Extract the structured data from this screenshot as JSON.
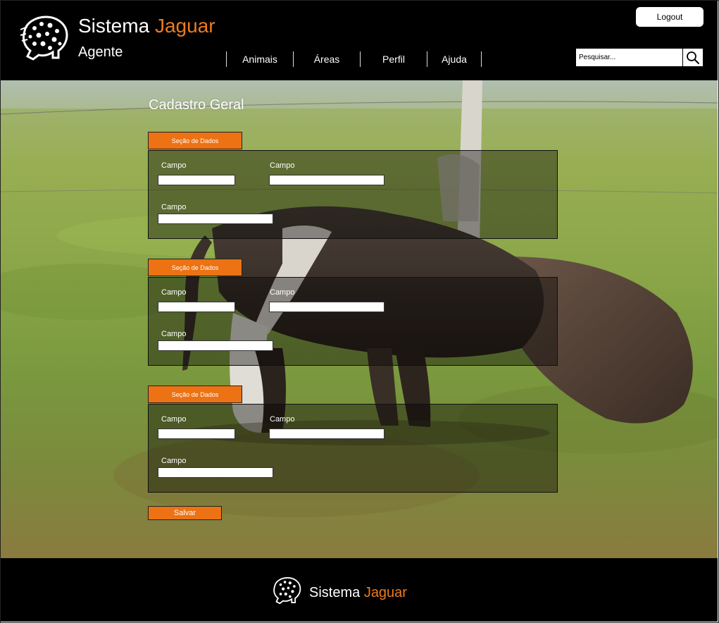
{
  "header": {
    "brand_prefix": "Sistema",
    "brand_accent": "Jaguar",
    "subtitle": "Agente",
    "logout_label": "Logout",
    "nav": [
      {
        "label": "Animais"
      },
      {
        "label": "Áreas"
      },
      {
        "label": "Perfil"
      },
      {
        "label": "Ajuda"
      }
    ],
    "search": {
      "placeholder": "Pesquisar...",
      "value": ""
    }
  },
  "main": {
    "title": "Cadastro Geral",
    "sections": [
      {
        "tab_label": "Seção de Dados",
        "fields": [
          {
            "label": "Campo",
            "value": ""
          },
          {
            "label": "Campo",
            "value": ""
          },
          {
            "label": "Campo",
            "value": ""
          }
        ]
      },
      {
        "tab_label": "Seção de Dados",
        "fields": [
          {
            "label": "Campo",
            "value": ""
          },
          {
            "label": "Campo",
            "value": ""
          },
          {
            "label": "Campo",
            "value": ""
          }
        ]
      },
      {
        "tab_label": "Seção de Dados",
        "fields": [
          {
            "label": "Campo",
            "value": ""
          },
          {
            "label": "Campo",
            "value": ""
          },
          {
            "label": "Campo",
            "value": ""
          }
        ]
      }
    ],
    "save_label": "Salvar"
  },
  "footer": {
    "brand_prefix": "Sistema",
    "brand_accent": "Jaguar"
  },
  "colors": {
    "accent": "#ec7214",
    "header_bg": "#000000",
    "brand_accent": "#ec7b1f"
  },
  "icons": {
    "logo": "jaguar-logo-icon",
    "search": "search-icon"
  }
}
